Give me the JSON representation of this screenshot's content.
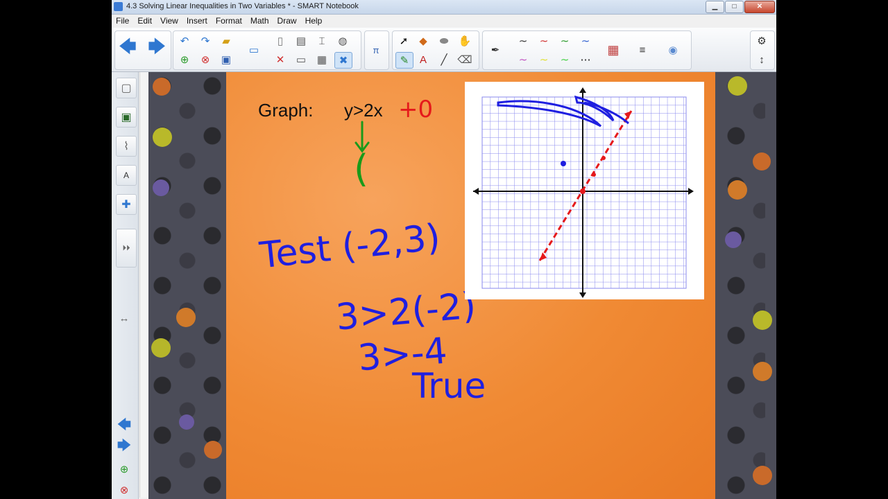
{
  "window": {
    "title": "4.3 Solving Linear Inequalities in Two Variables * - SMART Notebook",
    "min_label": "▁",
    "max_label": "□",
    "close_label": "✕"
  },
  "menu": [
    "File",
    "Edit",
    "View",
    "Insert",
    "Format",
    "Math",
    "Draw",
    "Help"
  ],
  "canvas": {
    "graph_label": "Graph:",
    "inequality": "y>2x",
    "inequality_add": "+0",
    "test_label": "Test (-2,3)",
    "step1": "3>2(-2)",
    "step2": "3>-4",
    "result": "True",
    "paren": "("
  },
  "colors": {
    "accent_blue": "#1f1fe0",
    "pen_red": "#e5191b",
    "pen_green": "#1a9a1a",
    "grid_line": "#8888ee",
    "orange_bg": "#f08a34"
  }
}
